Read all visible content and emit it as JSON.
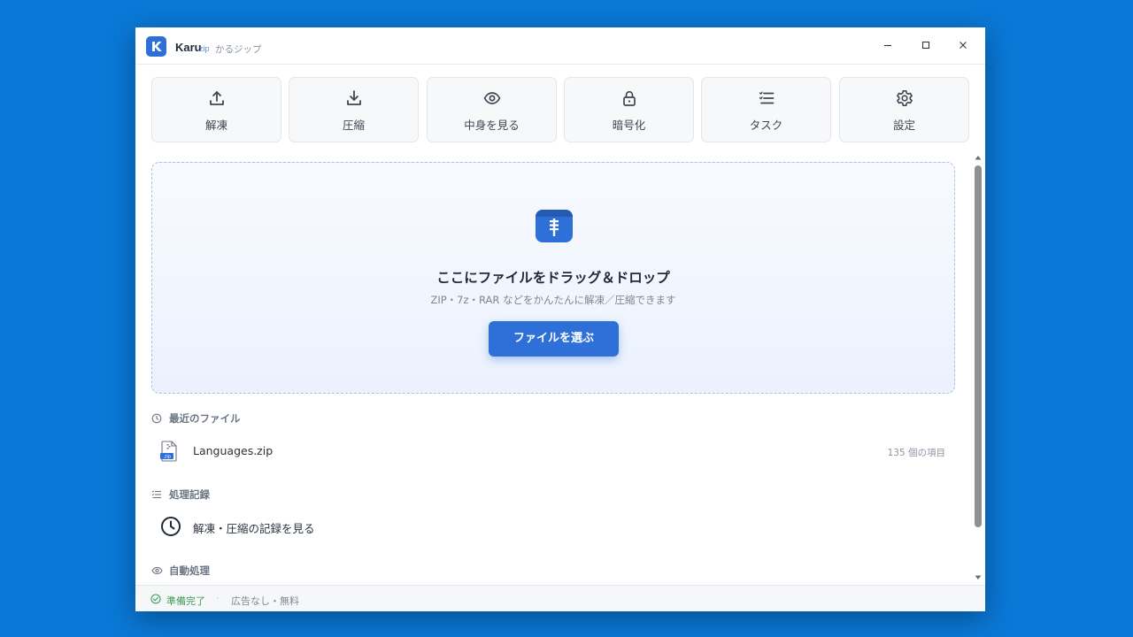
{
  "app": {
    "name": "Karu",
    "name_suffix": "zip",
    "tagline": "かるジップ"
  },
  "window_controls": {
    "minimize": "minimize-icon",
    "maximize": "maximize-icon",
    "close": "close-icon"
  },
  "toolbar": {
    "items": [
      {
        "label": "解凍",
        "icon": "upload-icon"
      },
      {
        "label": "圧縮",
        "icon": "download-icon"
      },
      {
        "label": "中身を見る",
        "icon": "eye-icon"
      },
      {
        "label": "暗号化",
        "icon": "lock-icon"
      },
      {
        "label": "タスク",
        "icon": "list-check-icon"
      },
      {
        "label": "設定",
        "icon": "gear-icon"
      }
    ]
  },
  "dropzone": {
    "icon": "zip-archive-icon",
    "title": "ここにファイルをドラッグ＆ドロップ",
    "subtitle": "ZIP・7z・RAR などをかんたんに解凍／圧縮できます",
    "button_label": "ファイルを選ぶ"
  },
  "recent": {
    "heading": "最近のファイル",
    "items": [
      {
        "name": "Languages.zip",
        "meta": "135 個の項目",
        "icon_text": ".zip"
      }
    ]
  },
  "history": {
    "heading": "処理記録",
    "link_label": "解凍・圧縮の記録を見る"
  },
  "auto": {
    "heading": "自動処理"
  },
  "status": {
    "ready": "準備完了",
    "separator": "·",
    "extra": "広告なし・無料"
  },
  "colors": {
    "accent": "#2f6fd8",
    "desktop": "#0a78d7",
    "status_ok": "#3e9b57"
  }
}
